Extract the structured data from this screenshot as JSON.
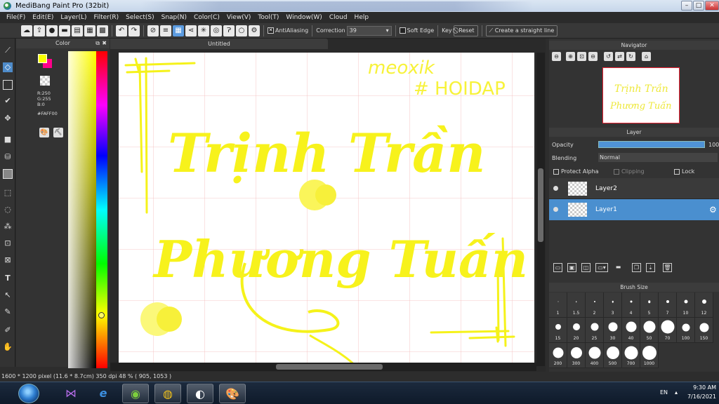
{
  "window": {
    "title": "MediBang Paint Pro (32bit)"
  },
  "menu": [
    "File(F)",
    "Edit(E)",
    "Layer(L)",
    "Filter(R)",
    "Select(S)",
    "Snap(N)",
    "Color(C)",
    "View(V)",
    "Tool(T)",
    "Window(W)",
    "Cloud",
    "Help"
  ],
  "toolbar": {
    "antialiasing": "AntiAliasing",
    "correction_label": "Correction",
    "correction_value": "39",
    "soft_edge": "Soft Edge",
    "key": "Key",
    "reset": "Reset",
    "straight_line": "Create a straight line"
  },
  "color_panel": {
    "title": "Color",
    "r": "R:250",
    "g": "G:255",
    "b": "B:0",
    "hex": "#FAFF00",
    "foreground": "#FAFF00",
    "background": "#FF008A"
  },
  "canvas": {
    "tab_title": "Untitled",
    "artwork_lines": [
      "meoxik",
      "# HOIDAP",
      "Trịnh Trần",
      "Phương Tuấn"
    ],
    "ink_color": "#FAF51C"
  },
  "navigator": {
    "title": "Navigator"
  },
  "layer_panel": {
    "title": "Layer",
    "opacity_label": "Opacity",
    "opacity_value": "100",
    "blending_label": "Blending",
    "blending_value": "Normal",
    "protect_alpha": "Protect Alpha",
    "clipping": "Clipping",
    "lock": "Lock",
    "layers": [
      {
        "name": "Layer2",
        "selected": false
      },
      {
        "name": "Layer1",
        "selected": true
      }
    ],
    "selected_color": "#4a8fcf"
  },
  "brush_size": {
    "title": "Brush Size",
    "sizes": [
      "1",
      "1.5",
      "2",
      "3",
      "4",
      "5",
      "7",
      "10",
      "12",
      "15",
      "20",
      "25",
      "30",
      "40",
      "50",
      "70",
      "100",
      "150",
      "200",
      "300",
      "400",
      "500",
      "700",
      "1000"
    ]
  },
  "status": {
    "text": "1600 * 1200 pixel  (11.6 * 8.7cm)  350 dpi  48 %  ( 905, 1053 )"
  },
  "taskbar": {
    "language": "EN",
    "time": "9:30 AM",
    "date": "7/16/2021"
  }
}
